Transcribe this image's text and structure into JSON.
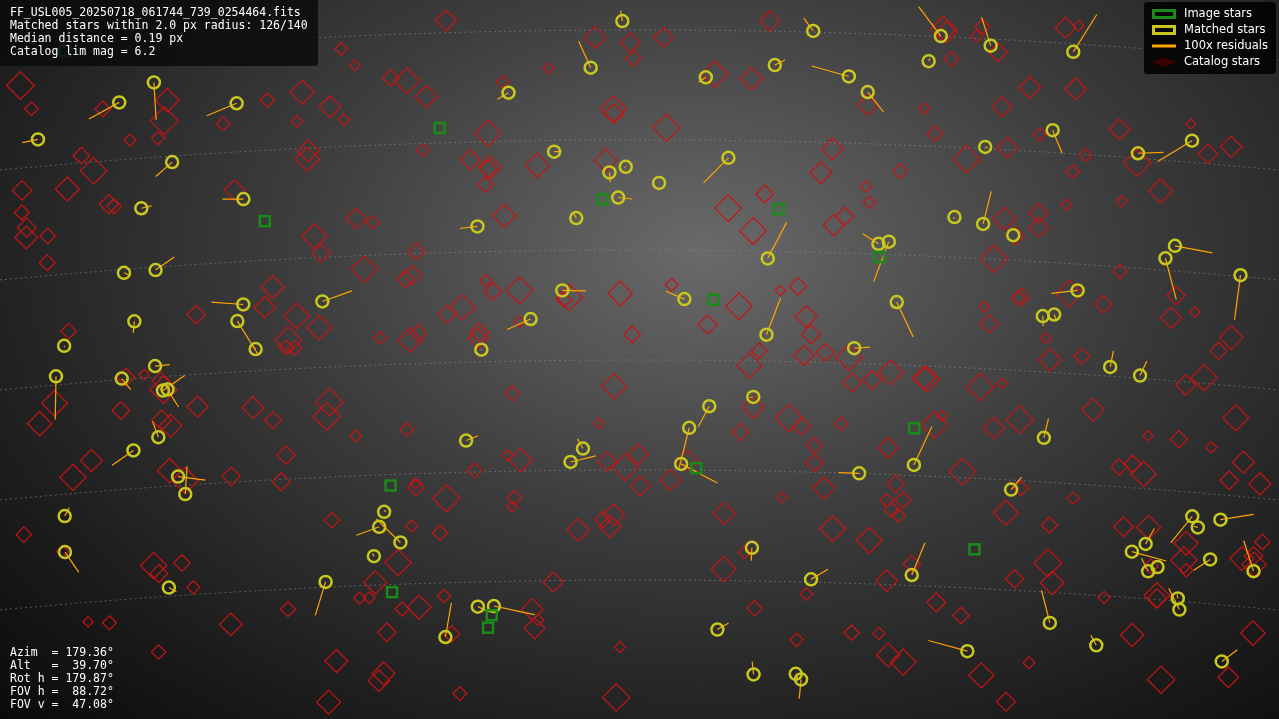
{
  "info_box": {
    "lines": [
      "FF_USL005_20250718_061744_739_0254464.fits",
      "Matched stars within 2.0 px radius: 126/140",
      "Median distance = 0.19 px",
      "Catalog lim mag = 6.2"
    ]
  },
  "legend": {
    "items": [
      {
        "kind": "box",
        "color": "#1a8a1a",
        "label": "Image stars"
      },
      {
        "kind": "box",
        "color": "#c8c81e",
        "label": "Matched stars"
      },
      {
        "kind": "line",
        "color": "#ffa500",
        "label": "100x residuals"
      },
      {
        "kind": "diamond",
        "color": "#3a0000",
        "label": "Catalog stars"
      }
    ]
  },
  "pointing": {
    "lines": [
      "Azim  = 179.36°",
      "Alt   =  39.70°",
      "Rot h = 179.87°",
      "FOV h =  88.72°",
      "FOV v =  47.08°"
    ]
  }
}
